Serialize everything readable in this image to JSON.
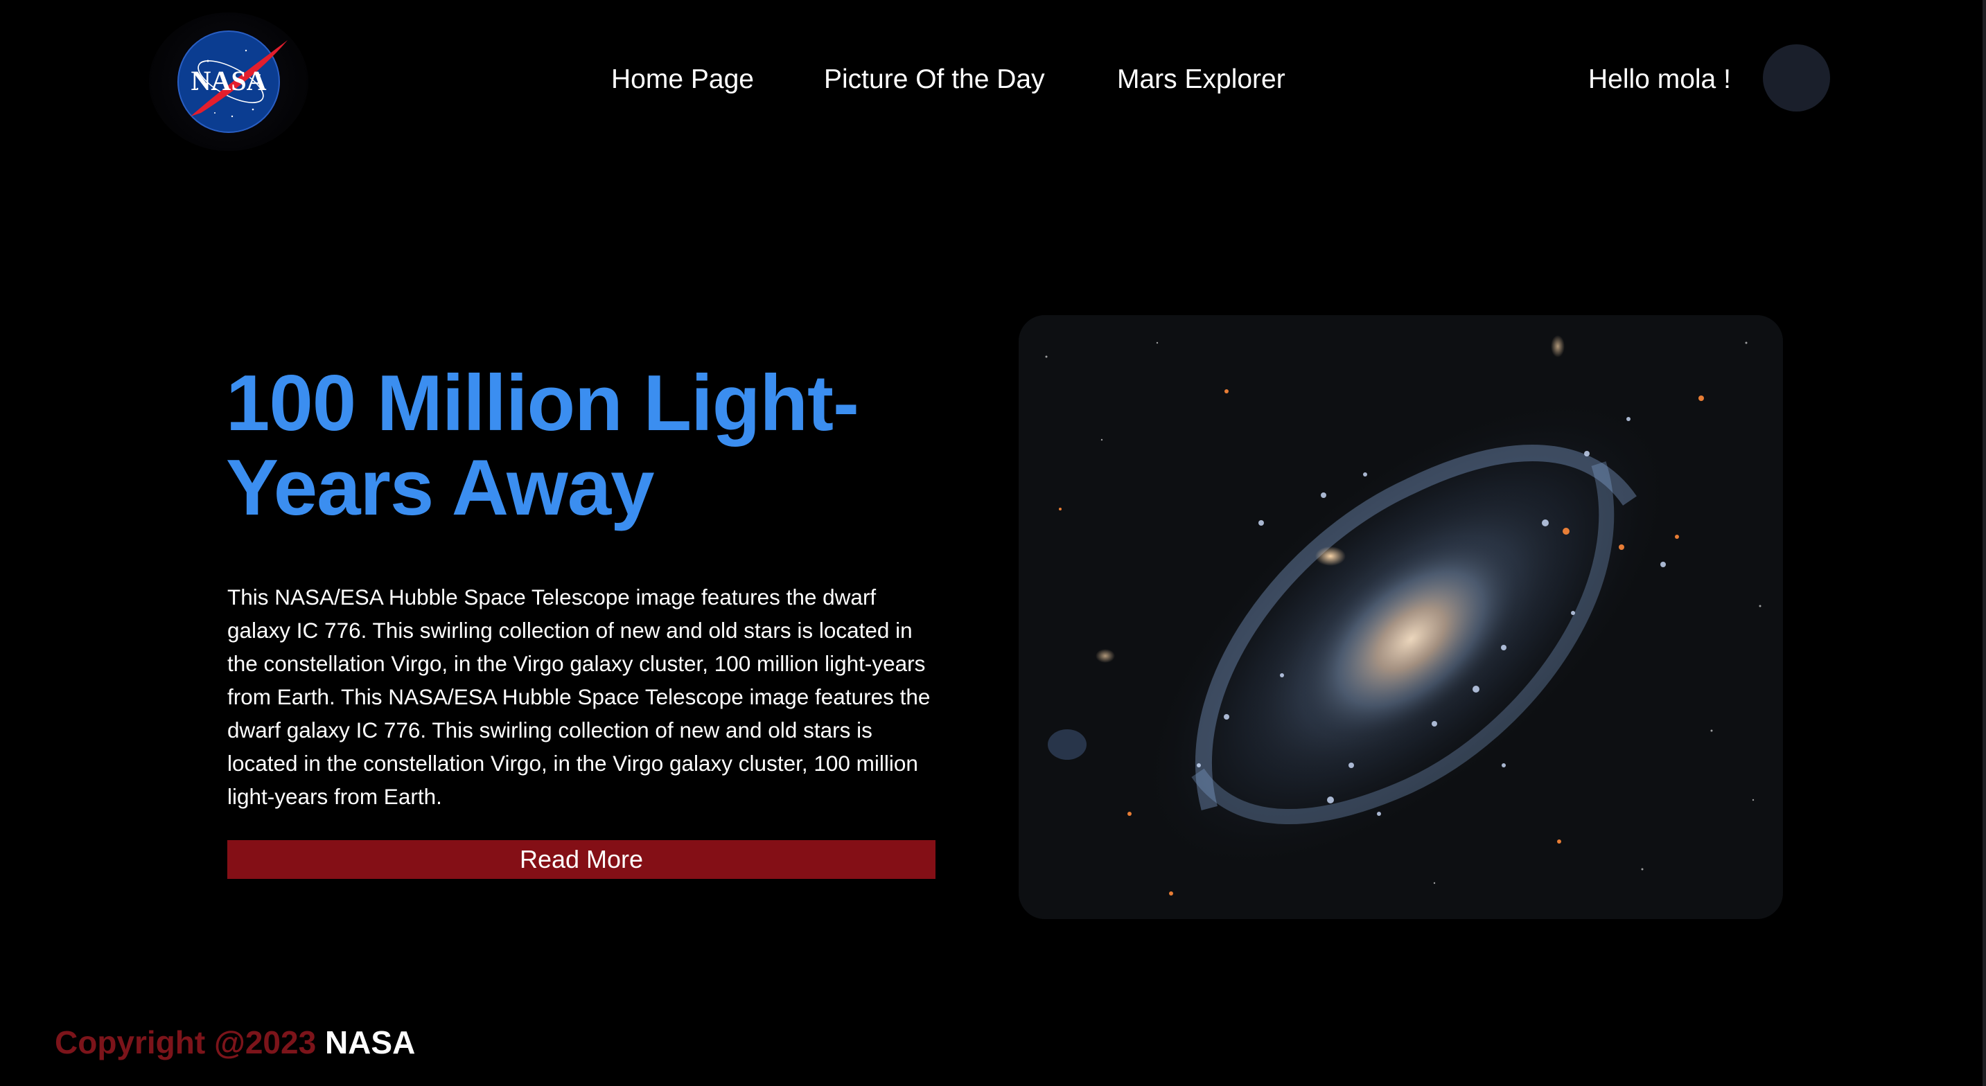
{
  "header": {
    "logo_text": "NASA",
    "nav": [
      {
        "label": "Home Page"
      },
      {
        "label": "Picture Of the Day"
      },
      {
        "label": "Mars Explorer"
      }
    ],
    "greeting": "Hello mola !"
  },
  "hero": {
    "title": "100 Million Light-Years Away",
    "description": "This NASA/ESA Hubble Space Telescope image features the dwarf galaxy IC 776. This swirling collection of new and old stars is located in the constellation Virgo, in the Virgo galaxy cluster, 100 million light-years from Earth. This NASA/ESA Hubble Space Telescope image features the dwarf galaxy IC 776. This swirling collection of new and old stars is located in the constellation Virgo, in the Virgo galaxy cluster, 100 million light-years from Earth.",
    "button_label": "Read More",
    "image_icon": "galaxy-image"
  },
  "footer": {
    "copyright": "Copyright @2023",
    "brand": "NASA"
  },
  "colors": {
    "background": "#000000",
    "accent_title": "#3b8ef0",
    "button": "#840f16",
    "footer_copyright": "#7c141a",
    "avatar": "#1a1f2b"
  }
}
